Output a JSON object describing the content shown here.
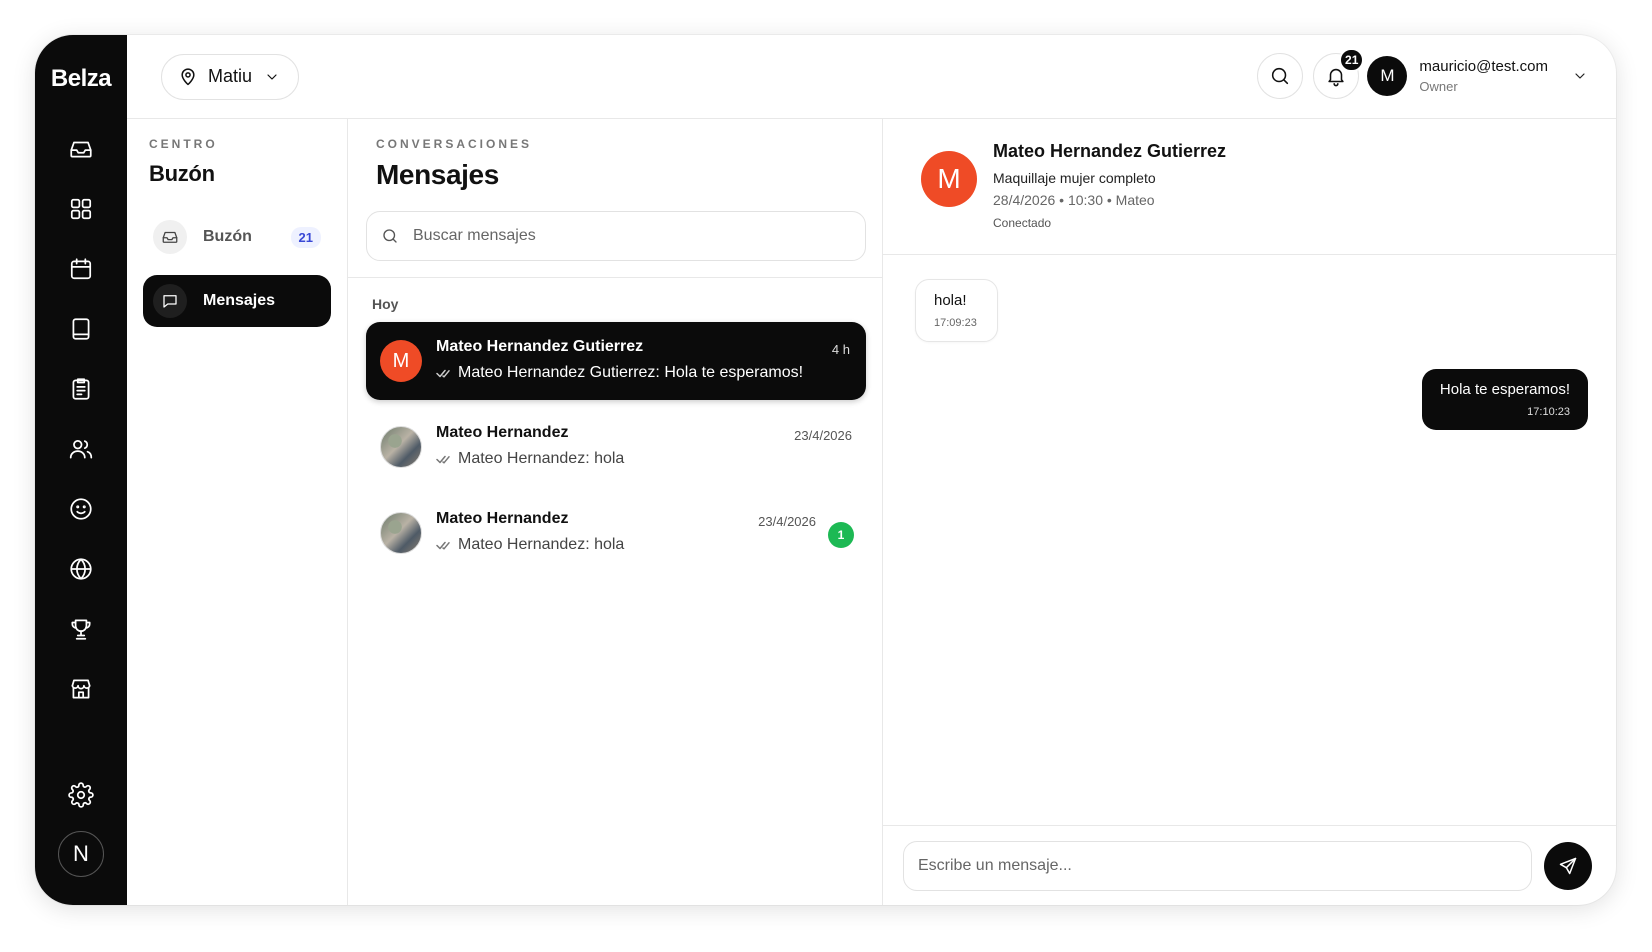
{
  "app": {
    "brand": "Belza"
  },
  "rail": {
    "icons": [
      "inbox-icon",
      "grid-icon",
      "calendar-icon",
      "book-icon",
      "clipboard-icon",
      "users-icon",
      "smile-icon",
      "globe-icon",
      "trophy-icon",
      "store-icon"
    ],
    "settings_icon": "gear-icon",
    "avatar_letter": "N"
  },
  "topbar": {
    "location": "Matiu",
    "notifications_count": "21",
    "user_initial": "M",
    "user_email": "mauricio@test.com",
    "user_role": "Owner"
  },
  "subnav": {
    "eyebrow": "CENTRO",
    "title": "Buzón",
    "items": [
      {
        "label": "Buzón",
        "count": "21",
        "active": false
      },
      {
        "label": "Mensajes",
        "active": true
      }
    ]
  },
  "conversations": {
    "eyebrow": "CONVERSACIONES",
    "title": "Mensajes",
    "search_placeholder": "Buscar mensajes",
    "group_label": "Hoy",
    "items": [
      {
        "avatar_letter": "M",
        "name": "Mateo Hernandez Gutierrez",
        "preview": "Mateo Hernandez Gutierrez: Hola te esperamos!",
        "time": "4 h",
        "active": true
      },
      {
        "name": "Mateo Hernandez",
        "preview": "Mateo Hernandez: hola",
        "time": "23/4/2026"
      },
      {
        "name": "Mateo Hernandez",
        "preview": "Mateo Hernandez: hola",
        "time": "23/4/2026",
        "unread": "1"
      }
    ]
  },
  "chat": {
    "avatar_letter": "M",
    "name": "Mateo Hernandez Gutierrez",
    "service": "Maquillaje mujer completo",
    "meta": "28/4/2026 • 10:30 • Mateo",
    "status": "Conectado",
    "messages": [
      {
        "direction": "in",
        "text": "hola!",
        "time": "17:09:23"
      },
      {
        "direction": "out",
        "text": "Hola te esperamos!",
        "time": "17:10:23"
      }
    ],
    "composer_placeholder": "Escribe un mensaje..."
  }
}
